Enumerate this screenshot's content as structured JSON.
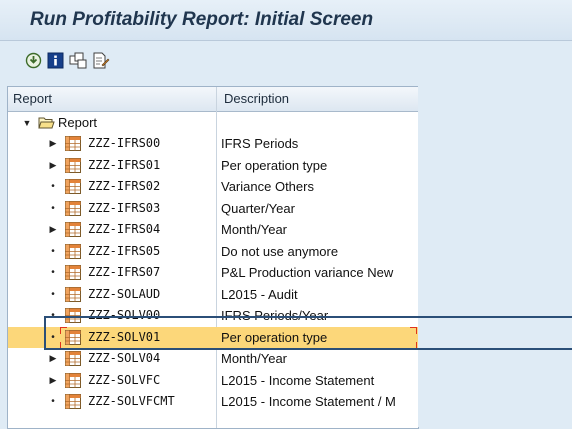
{
  "title": "Run Profitability Report: Initial Screen",
  "toolbar": {
    "buttons": [
      {
        "icon": "execute-icon"
      },
      {
        "icon": "information-icon"
      },
      {
        "icon": "hierarchy-icon"
      },
      {
        "icon": "edit-document-icon"
      }
    ]
  },
  "tree": {
    "headers": {
      "report": "Report",
      "description": "Description"
    },
    "root": {
      "label": "Report",
      "icon": "folder-open-icon"
    },
    "rows": [
      {
        "name": "ZZZ-IFRS00",
        "desc": "IFRS Periods",
        "expand": "triangle"
      },
      {
        "name": "ZZZ-IFRS01",
        "desc": "Per operation type",
        "expand": "triangle"
      },
      {
        "name": "ZZZ-IFRS02",
        "desc": "Variance Others",
        "expand": "dot"
      },
      {
        "name": "ZZZ-IFRS03",
        "desc": "Quarter/Year",
        "expand": "dot"
      },
      {
        "name": "ZZZ-IFRS04",
        "desc": "Month/Year",
        "expand": "triangle"
      },
      {
        "name": "ZZZ-IFRS05",
        "desc": "Do not use anymore",
        "expand": "dot"
      },
      {
        "name": "ZZZ-IFRS07",
        "desc": "P&L Production variance New",
        "expand": "dot"
      },
      {
        "name": "ZZZ-SOLAUD",
        "desc": "L2015 - Audit",
        "expand": "dot"
      },
      {
        "name": "ZZZ-SOLV00",
        "desc": "IFRS Periods/Year",
        "expand": "dot"
      },
      {
        "name": "ZZZ-SOLV01",
        "desc": "Per operation type",
        "expand": "dot",
        "selected": true
      },
      {
        "name": "ZZZ-SOLV04",
        "desc": "Month/Year",
        "expand": "triangle"
      },
      {
        "name": "ZZZ-SOLVFC",
        "desc": "L2015 - Income Statement",
        "expand": "triangle"
      },
      {
        "name": "ZZZ-SOLVFCMT",
        "desc": "L2015 - Income Statement / M",
        "expand": "dot"
      }
    ]
  },
  "colors": {
    "selection": "#fcd77a",
    "focus": "#e0321c",
    "highlight_box": "#2b4f78",
    "background": "#dfebf5"
  }
}
